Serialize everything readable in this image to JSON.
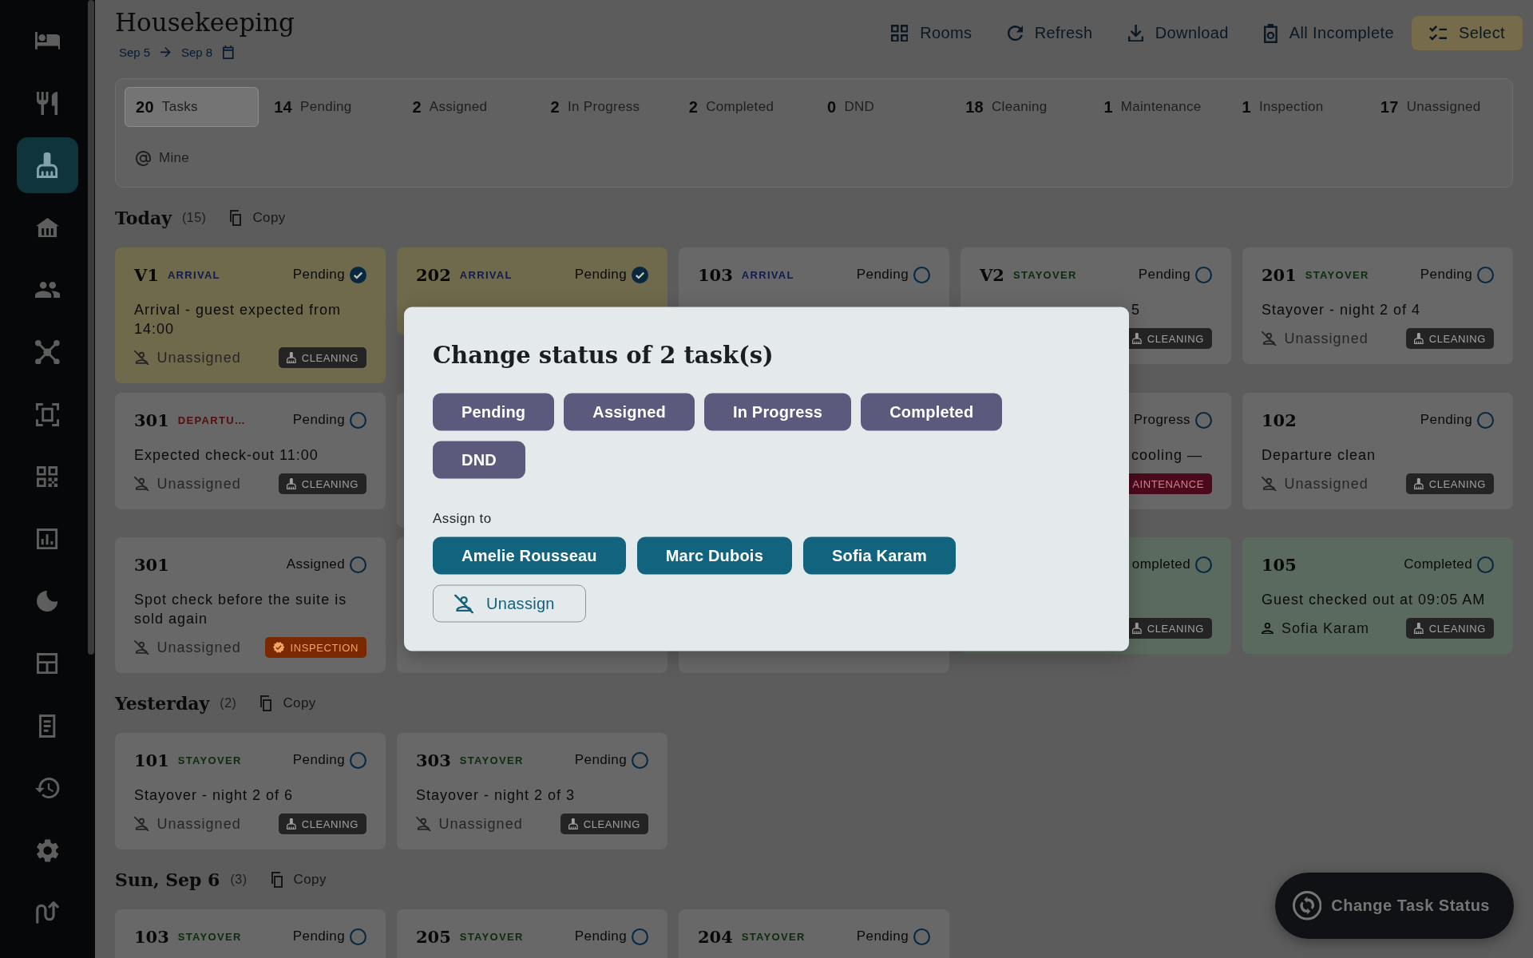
{
  "sidebar": {
    "items": [
      {
        "kind": "bed",
        "selected": false
      },
      {
        "kind": "fork_knife",
        "selected": false
      },
      {
        "kind": "brush",
        "selected": true
      },
      {
        "kind": "house",
        "selected": false
      },
      {
        "kind": "people",
        "selected": false
      },
      {
        "kind": "nodes",
        "selected": false
      },
      {
        "kind": "scan",
        "selected": false
      },
      {
        "kind": "qr",
        "selected": false
      },
      {
        "kind": "chart",
        "selected": false
      },
      {
        "kind": "moon",
        "selected": false
      },
      {
        "kind": "layout",
        "selected": false
      },
      {
        "kind": "receipt",
        "selected": false
      },
      {
        "kind": "history",
        "selected": false
      },
      {
        "kind": "gear",
        "selected": false
      },
      {
        "kind": "route",
        "selected": false
      }
    ]
  },
  "header": {
    "title": "Housekeeping",
    "date_from": "Sep 5",
    "date_to": "Sep 8",
    "actions": [
      {
        "kind": "grid",
        "label": "Rooms",
        "selected": false
      },
      {
        "kind": "refresh",
        "label": "Refresh",
        "selected": false
      },
      {
        "kind": "download",
        "label": "Download",
        "selected": false
      },
      {
        "kind": "clipboard",
        "label": "All Incomplete",
        "selected": false
      },
      {
        "kind": "checklist",
        "label": "Select",
        "selected": true
      }
    ]
  },
  "filters": {
    "items": [
      {
        "kind": "count",
        "count": "20",
        "label": "Tasks",
        "selected": true
      },
      {
        "kind": "count",
        "count": "14",
        "label": "Pending",
        "selected": false
      },
      {
        "kind": "count",
        "count": "2",
        "label": "Assigned",
        "selected": false
      },
      {
        "kind": "count",
        "count": "2",
        "label": "In Progress",
        "selected": false
      },
      {
        "kind": "count",
        "count": "2",
        "label": "Completed",
        "selected": false
      },
      {
        "kind": "count",
        "count": "0",
        "label": "DND",
        "selected": false
      },
      {
        "kind": "count",
        "count": "18",
        "label": "Cleaning",
        "selected": false
      },
      {
        "kind": "count",
        "count": "1",
        "label": "Maintenance",
        "selected": false
      },
      {
        "kind": "count",
        "count": "1",
        "label": "Inspection",
        "selected": false
      },
      {
        "kind": "count",
        "count": "17",
        "label": "Unassigned",
        "selected": false
      },
      {
        "kind": "at",
        "label": "Mine",
        "selected": false
      }
    ]
  },
  "sections": [
    {
      "title": "Today",
      "count": "(15)",
      "copy_label": "Copy",
      "cards": [
        {
          "kind": "task",
          "room": "V1",
          "tag": {
            "label": "ARRIVAL",
            "kind": "arrival"
          },
          "status": {
            "label": "Pending",
            "kind": "pending"
          },
          "selected": true,
          "description": "Arrival - guest expected from 14:00",
          "assignee": {
            "name": "Unassigned",
            "assigned": false
          },
          "badge": {
            "label": "CLEANING",
            "kind": "cleaning"
          }
        },
        {
          "kind": "task",
          "room": "202",
          "tag": {
            "label": "ARRIVAL",
            "kind": "arrival"
          },
          "status": {
            "label": "Pending",
            "kind": "pending"
          },
          "selected": true
        },
        {
          "kind": "task",
          "room": "103",
          "tag": {
            "label": "ARRIVAL",
            "kind": "arrival"
          },
          "status": {
            "label": "Pending",
            "kind": "pending"
          },
          "selected": false
        },
        {
          "kind": "task",
          "room": "V2",
          "tag": {
            "label": "STAYOVER",
            "kind": "stayover"
          },
          "status": {
            "label": "Pending",
            "kind": "pending"
          },
          "selected": false,
          "description_tail": "5",
          "badge": {
            "label": "CLEANING",
            "kind": "cleaning"
          }
        },
        {
          "kind": "task",
          "room": "201",
          "tag": {
            "label": "STAYOVER",
            "kind": "stayover"
          },
          "status": {
            "label": "Pending",
            "kind": "pending"
          },
          "selected": false,
          "description": "Stayover - night 2 of 4",
          "assignee": {
            "name": "Unassigned",
            "assigned": false
          },
          "badge": {
            "label": "CLEANING",
            "kind": "cleaning"
          }
        },
        {
          "kind": "task",
          "room": "301",
          "tag": {
            "label": "DEPARTU…",
            "kind": "departure"
          },
          "status": {
            "label": "Pending",
            "kind": "pending"
          },
          "selected": false,
          "description": "Expected check-out 11:00",
          "assignee": {
            "name": "Unassigned",
            "assigned": false
          },
          "badge": {
            "label": "CLEANING",
            "kind": "cleaning"
          }
        },
        {
          "kind": "blank"
        },
        {
          "kind": "gap"
        },
        {
          "kind": "task",
          "status": {
            "label": "Progress",
            "kind": "in_progress"
          },
          "selected": false,
          "description_tail": "cooling —",
          "badge": {
            "label": "AINTENANCE",
            "kind": "maintenance"
          }
        },
        {
          "kind": "task",
          "room": "102",
          "status": {
            "label": "Pending",
            "kind": "pending"
          },
          "selected": false,
          "description": "Departure clean",
          "assignee": {
            "name": "Unassigned",
            "assigned": false
          },
          "badge": {
            "label": "CLEANING",
            "kind": "cleaning"
          }
        },
        {
          "kind": "task",
          "room": "301",
          "status": {
            "label": "Assigned",
            "kind": "assigned"
          },
          "selected": false,
          "description": "Spot check before the suite is sold again",
          "assignee": {
            "name": "Unassigned",
            "assigned": false
          },
          "badge": {
            "label": "INSPECTION",
            "kind": "inspection"
          }
        },
        {
          "kind": "blank"
        },
        {
          "kind": "blank"
        },
        {
          "kind": "task",
          "status": {
            "label": "ompleted",
            "kind": "completed"
          },
          "selected": false,
          "badge": {
            "label": "CLEANING",
            "kind": "cleaning"
          }
        },
        {
          "kind": "task",
          "room": "105",
          "status": {
            "label": "Completed",
            "kind": "completed"
          },
          "selected": false,
          "description": "Guest checked out at 09:05 AM",
          "assignee": {
            "name": "Sofia Karam",
            "assigned": true
          },
          "badge": {
            "label": "CLEANING",
            "kind": "cleaning"
          }
        }
      ]
    },
    {
      "title": "Yesterday",
      "count": "(2)",
      "copy_label": "Copy",
      "cards": [
        {
          "kind": "task",
          "room": "101",
          "tag": {
            "label": "STAYOVER",
            "kind": "stayover"
          },
          "status": {
            "label": "Pending",
            "kind": "pending"
          },
          "selected": false,
          "description": "Stayover - night 2 of 6",
          "assignee": {
            "name": "Unassigned",
            "assigned": false
          },
          "badge": {
            "label": "CLEANING",
            "kind": "cleaning"
          }
        },
        {
          "kind": "task",
          "room": "303",
          "tag": {
            "label": "STAYOVER",
            "kind": "stayover"
          },
          "status": {
            "label": "Pending",
            "kind": "pending"
          },
          "selected": false,
          "description": "Stayover - night 2 of 3",
          "assignee": {
            "name": "Unassigned",
            "assigned": false
          },
          "badge": {
            "label": "CLEANING",
            "kind": "cleaning"
          }
        }
      ]
    },
    {
      "title": "Sun, Sep 6",
      "count": "(3)",
      "copy_label": "Copy",
      "cards": [
        {
          "kind": "task",
          "room": "103",
          "tag": {
            "label": "STAYOVER",
            "kind": "stayover"
          },
          "status": {
            "label": "Pending",
            "kind": "pending"
          },
          "selected": false
        },
        {
          "kind": "task",
          "room": "205",
          "tag": {
            "label": "STAYOVER",
            "kind": "stayover"
          },
          "status": {
            "label": "Pending",
            "kind": "pending"
          },
          "selected": false
        },
        {
          "kind": "task",
          "room": "204",
          "tag": {
            "label": "STAYOVER",
            "kind": "stayover"
          },
          "status": {
            "label": "Pending",
            "kind": "pending"
          },
          "selected": false
        }
      ]
    }
  ],
  "dialog": {
    "title": "Change status of 2 task(s)",
    "status_options": [
      "Pending",
      "Assigned",
      "In Progress",
      "Completed",
      "DND"
    ],
    "assign_label": "Assign to",
    "assignees": [
      "Amelie Rousseau",
      "Marc Dubois",
      "Sofia Karam"
    ],
    "unassign_label": "Unassign"
  },
  "fab": {
    "label": "Change Task Status"
  }
}
